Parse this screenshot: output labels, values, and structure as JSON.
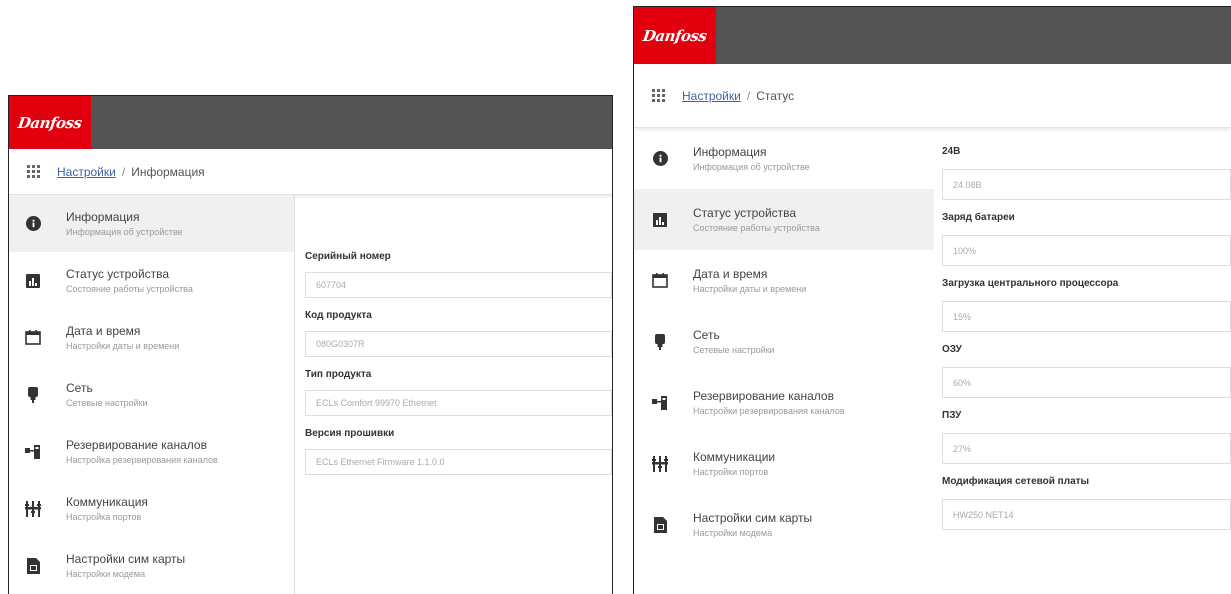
{
  "brand": {
    "logo_text": "Danfoss",
    "accent": "#e2000f",
    "topbar_color": "#545454"
  },
  "left": {
    "breadcrumb": {
      "root": "Настройки",
      "current": "Информация"
    },
    "nav": [
      {
        "icon": "info-icon",
        "title": "Информация",
        "subtitle": "Информация об устройстве"
      },
      {
        "icon": "chart-icon",
        "title": "Статус устройства",
        "subtitle": "Состояние работы устройства"
      },
      {
        "icon": "calendar-icon",
        "title": "Дата и время",
        "subtitle": "Настройки даты и времени"
      },
      {
        "icon": "network-icon",
        "title": "Сеть",
        "subtitle": "Сетевые настройки"
      },
      {
        "icon": "backup-icon",
        "title": "Резервирование каналов",
        "subtitle": "Настройка резервирования каналов"
      },
      {
        "icon": "ports-icon",
        "title": "Коммуникация",
        "subtitle": "Настройка портов"
      },
      {
        "icon": "sim-icon",
        "title": "Настройки сим карты",
        "subtitle": "Настройки модема"
      }
    ],
    "fields": [
      {
        "label": "Серийный номер",
        "value": "607704"
      },
      {
        "label": "Код продукта",
        "value": "080G0307R"
      },
      {
        "label": "Тип продукта",
        "value": "ECLs Comfort 99970 Ethernet"
      },
      {
        "label": "Версия прошивки",
        "value": "ECLs Ethernet Firmware 1.1.0.0"
      }
    ]
  },
  "right": {
    "breadcrumb": {
      "root": "Настройки",
      "current": "Статус"
    },
    "nav": [
      {
        "icon": "info-icon",
        "title": "Информация",
        "subtitle": "Информация об устройстве"
      },
      {
        "icon": "chart-icon",
        "title": "Статус устройства",
        "subtitle": "Состояние работы устройства"
      },
      {
        "icon": "calendar-icon",
        "title": "Дата и время",
        "subtitle": "Настройки даты и времени"
      },
      {
        "icon": "network-icon",
        "title": "Сеть",
        "subtitle": "Сетевые настройки"
      },
      {
        "icon": "backup-icon",
        "title": "Резервирование каналов",
        "subtitle": "Настройки резервирования каналов"
      },
      {
        "icon": "ports-icon",
        "title": "Коммуникации",
        "subtitle": "Настройки портов"
      },
      {
        "icon": "sim-icon",
        "title": "Настройки сим карты",
        "subtitle": "Настройки модема"
      }
    ],
    "fields": [
      {
        "label": "24В",
        "value": "24.08В"
      },
      {
        "label": "Заряд батареи",
        "value": "100%"
      },
      {
        "label": "Загрузка центрального процессора",
        "value": "15%"
      },
      {
        "label": "ОЗУ",
        "value": "60%"
      },
      {
        "label": "ПЗУ",
        "value": "27%"
      },
      {
        "label": "Модификация сетевой платы",
        "value": "HW250 NET14"
      }
    ]
  }
}
